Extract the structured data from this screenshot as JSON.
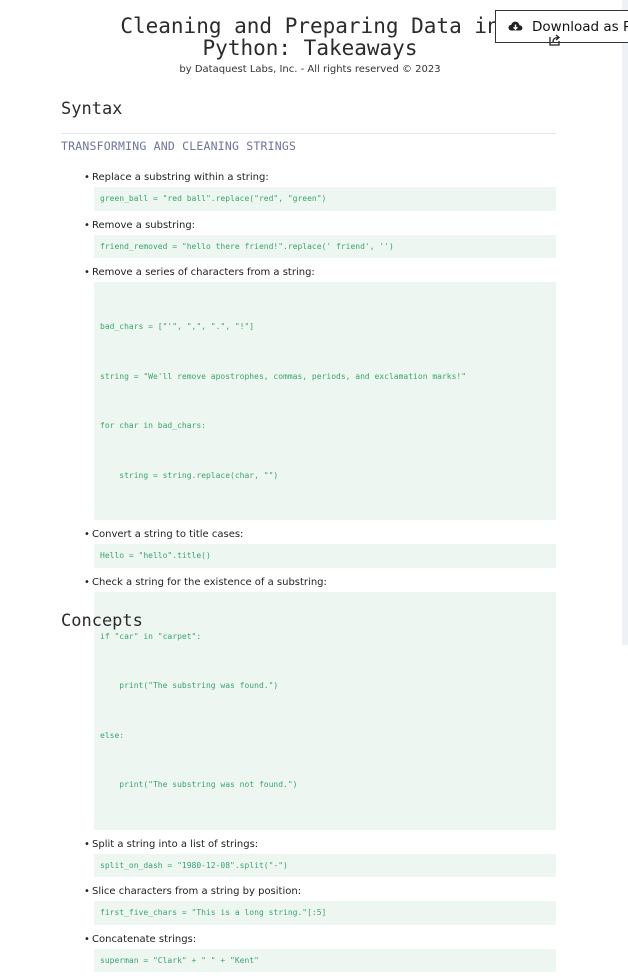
{
  "header": {
    "title_line1": "Cleaning and Preparing Data in",
    "title_line2": "Python: Takeaways",
    "byline": "by Dataquest Labs, Inc. - All rights reserved © 2023"
  },
  "download_button": {
    "label": "Download as PDF"
  },
  "sections": {
    "syntax_title": "Syntax",
    "concepts_title": "Concepts",
    "subheading": "TRANSFORMING AND CLEANING STRINGS"
  },
  "items": [
    {
      "label": "Replace a substring within a string:",
      "code": [
        "green_ball = \"red ball\".replace(\"red\", \"green\")"
      ]
    },
    {
      "label": "Remove a substring:",
      "code": [
        "friend_removed = \"hello there friend!\".replace(' friend', '')"
      ]
    },
    {
      "label": "Remove a series of characters from a string:",
      "code": [
        "bad_chars = [\"'\", \",\", \".\", \"!\"]",
        "string = \"We'll remove apostrophes, commas, periods, and exclamation marks!\"",
        "for char in bad_chars:",
        "    string = string.replace(char, \"\")"
      ]
    },
    {
      "label": "Convert a string to title cases:",
      "code": [
        "Hello = \"hello\".title()"
      ]
    },
    {
      "label": "Check a string for the existence of a substring:",
      "code": [
        "if \"car\" in \"carpet\":",
        "    print(\"The substring was found.\")",
        "else:",
        "    print(\"The substring was not found.\")"
      ]
    },
    {
      "label": "Split a string into a list of strings:",
      "code": [
        "split_on_dash = \"1980-12-08\".split(\"-\")"
      ]
    },
    {
      "label": "Slice characters from a string by position:",
      "code": [
        "first_five_chars = \"This is a long string.\"[:5]"
      ]
    },
    {
      "label": "Concatenate strings:",
      "code": [
        "superman = \"Clark\" + \" \" + \"Kent\""
      ]
    }
  ],
  "colors": {
    "code_bg": "#eef6f1",
    "code_text": "#3aa56c",
    "subheading": "#6c759a"
  },
  "icons": {
    "download": "cloud-download-icon",
    "share": "share-icon"
  }
}
